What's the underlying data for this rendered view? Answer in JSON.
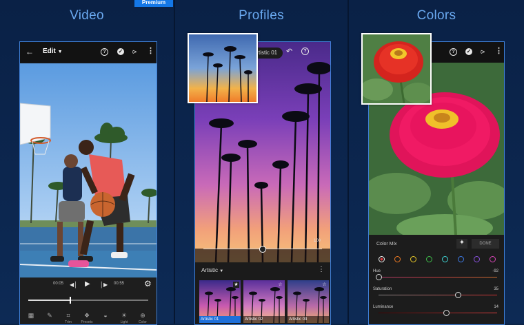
{
  "panels": {
    "video": {
      "title": "Video",
      "badge": "Premium"
    },
    "profiles": {
      "title": "Profiles"
    },
    "colors": {
      "title": "Colors"
    }
  },
  "video_screen": {
    "edit_label": "Edit",
    "time_start": "00:05",
    "time_end": "00:55",
    "scrub_fraction": 0.35,
    "tools": [
      {
        "label": "",
        "icon": "film-icon"
      },
      {
        "label": "",
        "icon": "brush-icon"
      },
      {
        "label": "Trim",
        "icon": "crop-icon"
      },
      {
        "label": "Presets",
        "icon": "presets-icon"
      },
      {
        "label": "",
        "icon": "drop-icon"
      },
      {
        "label": "Light",
        "icon": "sun-icon"
      },
      {
        "label": "Color",
        "icon": "thermometer-icon"
      }
    ]
  },
  "profiles_screen": {
    "profile_name": "Artistic 01",
    "amount_value": "100",
    "amount_fraction": 0.5,
    "category": "Artistic",
    "thumbnails": [
      {
        "label": "Artistic 01",
        "selected": true
      },
      {
        "label": "Artistic 02",
        "selected": false
      },
      {
        "label": "Artistic 03",
        "selected": false
      }
    ]
  },
  "colors_screen": {
    "panel_title": "Color Mix",
    "done_label": "DONE",
    "color_dots": [
      "#e0393b",
      "#ee7a23",
      "#e8c928",
      "#3fbf4a",
      "#3fd6d6",
      "#3d7be8",
      "#8a52e0",
      "#d645b5"
    ],
    "sliders": [
      {
        "label": "Hue",
        "value": "-92",
        "fraction": 0.0
      },
      {
        "label": "Saturation",
        "value": "35",
        "fraction": 0.67
      },
      {
        "label": "Luminance",
        "value": "14",
        "fraction": 0.57
      }
    ]
  }
}
